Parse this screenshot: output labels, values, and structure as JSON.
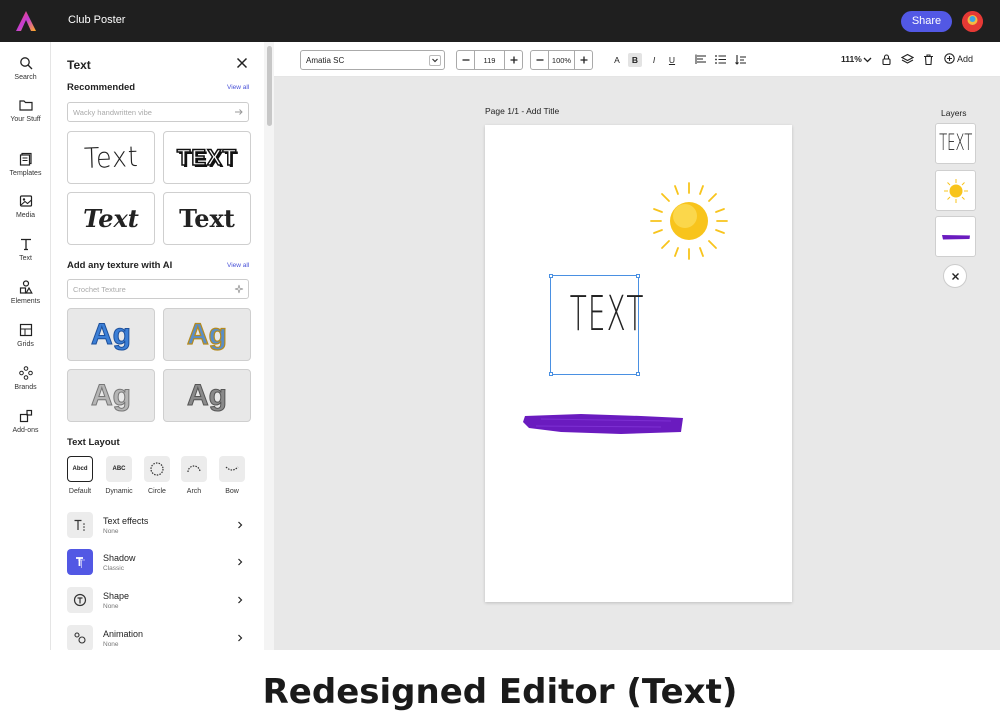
{
  "app": {
    "title": "Club Poster",
    "share_label": "Share"
  },
  "rail": [
    {
      "name": "search",
      "label": "Search"
    },
    {
      "name": "your-stuff",
      "label": "Your Stuff"
    },
    {
      "name": "templates",
      "label": "Templates"
    },
    {
      "name": "media",
      "label": "Media"
    },
    {
      "name": "text",
      "label": "Text"
    },
    {
      "name": "elements",
      "label": "Elements"
    },
    {
      "name": "grids",
      "label": "Grids"
    },
    {
      "name": "brands",
      "label": "Brands"
    },
    {
      "name": "add-ons",
      "label": "Add-ons"
    }
  ],
  "panel": {
    "title": "Text",
    "recommended": {
      "title": "Recommended",
      "view_all": "View all",
      "search_placeholder": "Wacky handwritten vibe",
      "sample": "Text"
    },
    "texture": {
      "title": "Add any texture with AI",
      "view_all": "View all",
      "search_placeholder": "Crochet Texture",
      "sample": "Ag"
    },
    "layout": {
      "title": "Text Layout",
      "options": [
        {
          "label": "Default",
          "preview": "Abcd"
        },
        {
          "label": "Dynamic",
          "preview": "ABC"
        },
        {
          "label": "Circle",
          "preview": ""
        },
        {
          "label": "Arch",
          "preview": ""
        },
        {
          "label": "Bow",
          "preview": ""
        }
      ]
    },
    "properties": [
      {
        "name": "Text effects",
        "value": "None"
      },
      {
        "name": "Shadow",
        "value": "Classic"
      },
      {
        "name": "Shape",
        "value": "None"
      },
      {
        "name": "Animation",
        "value": "None"
      }
    ]
  },
  "toolbar": {
    "font": "Amatia SC",
    "size": "119",
    "opacity": "100%",
    "format": {
      "a": "A",
      "b": "B",
      "i": "I",
      "u": "U"
    },
    "zoom": "111%",
    "add_label": "Add"
  },
  "canvas": {
    "page_label": "Page 1/1 - Add Title",
    "text": "Text"
  },
  "layers": {
    "title": "Layers",
    "text_thumb": "Text"
  },
  "caption": "Redesigned Editor (Text)",
  "colors": {
    "accent": "#5258e4",
    "brush": "#6a1bbf",
    "sun": "#f8c41c",
    "topbar": "#1f1f1f"
  }
}
